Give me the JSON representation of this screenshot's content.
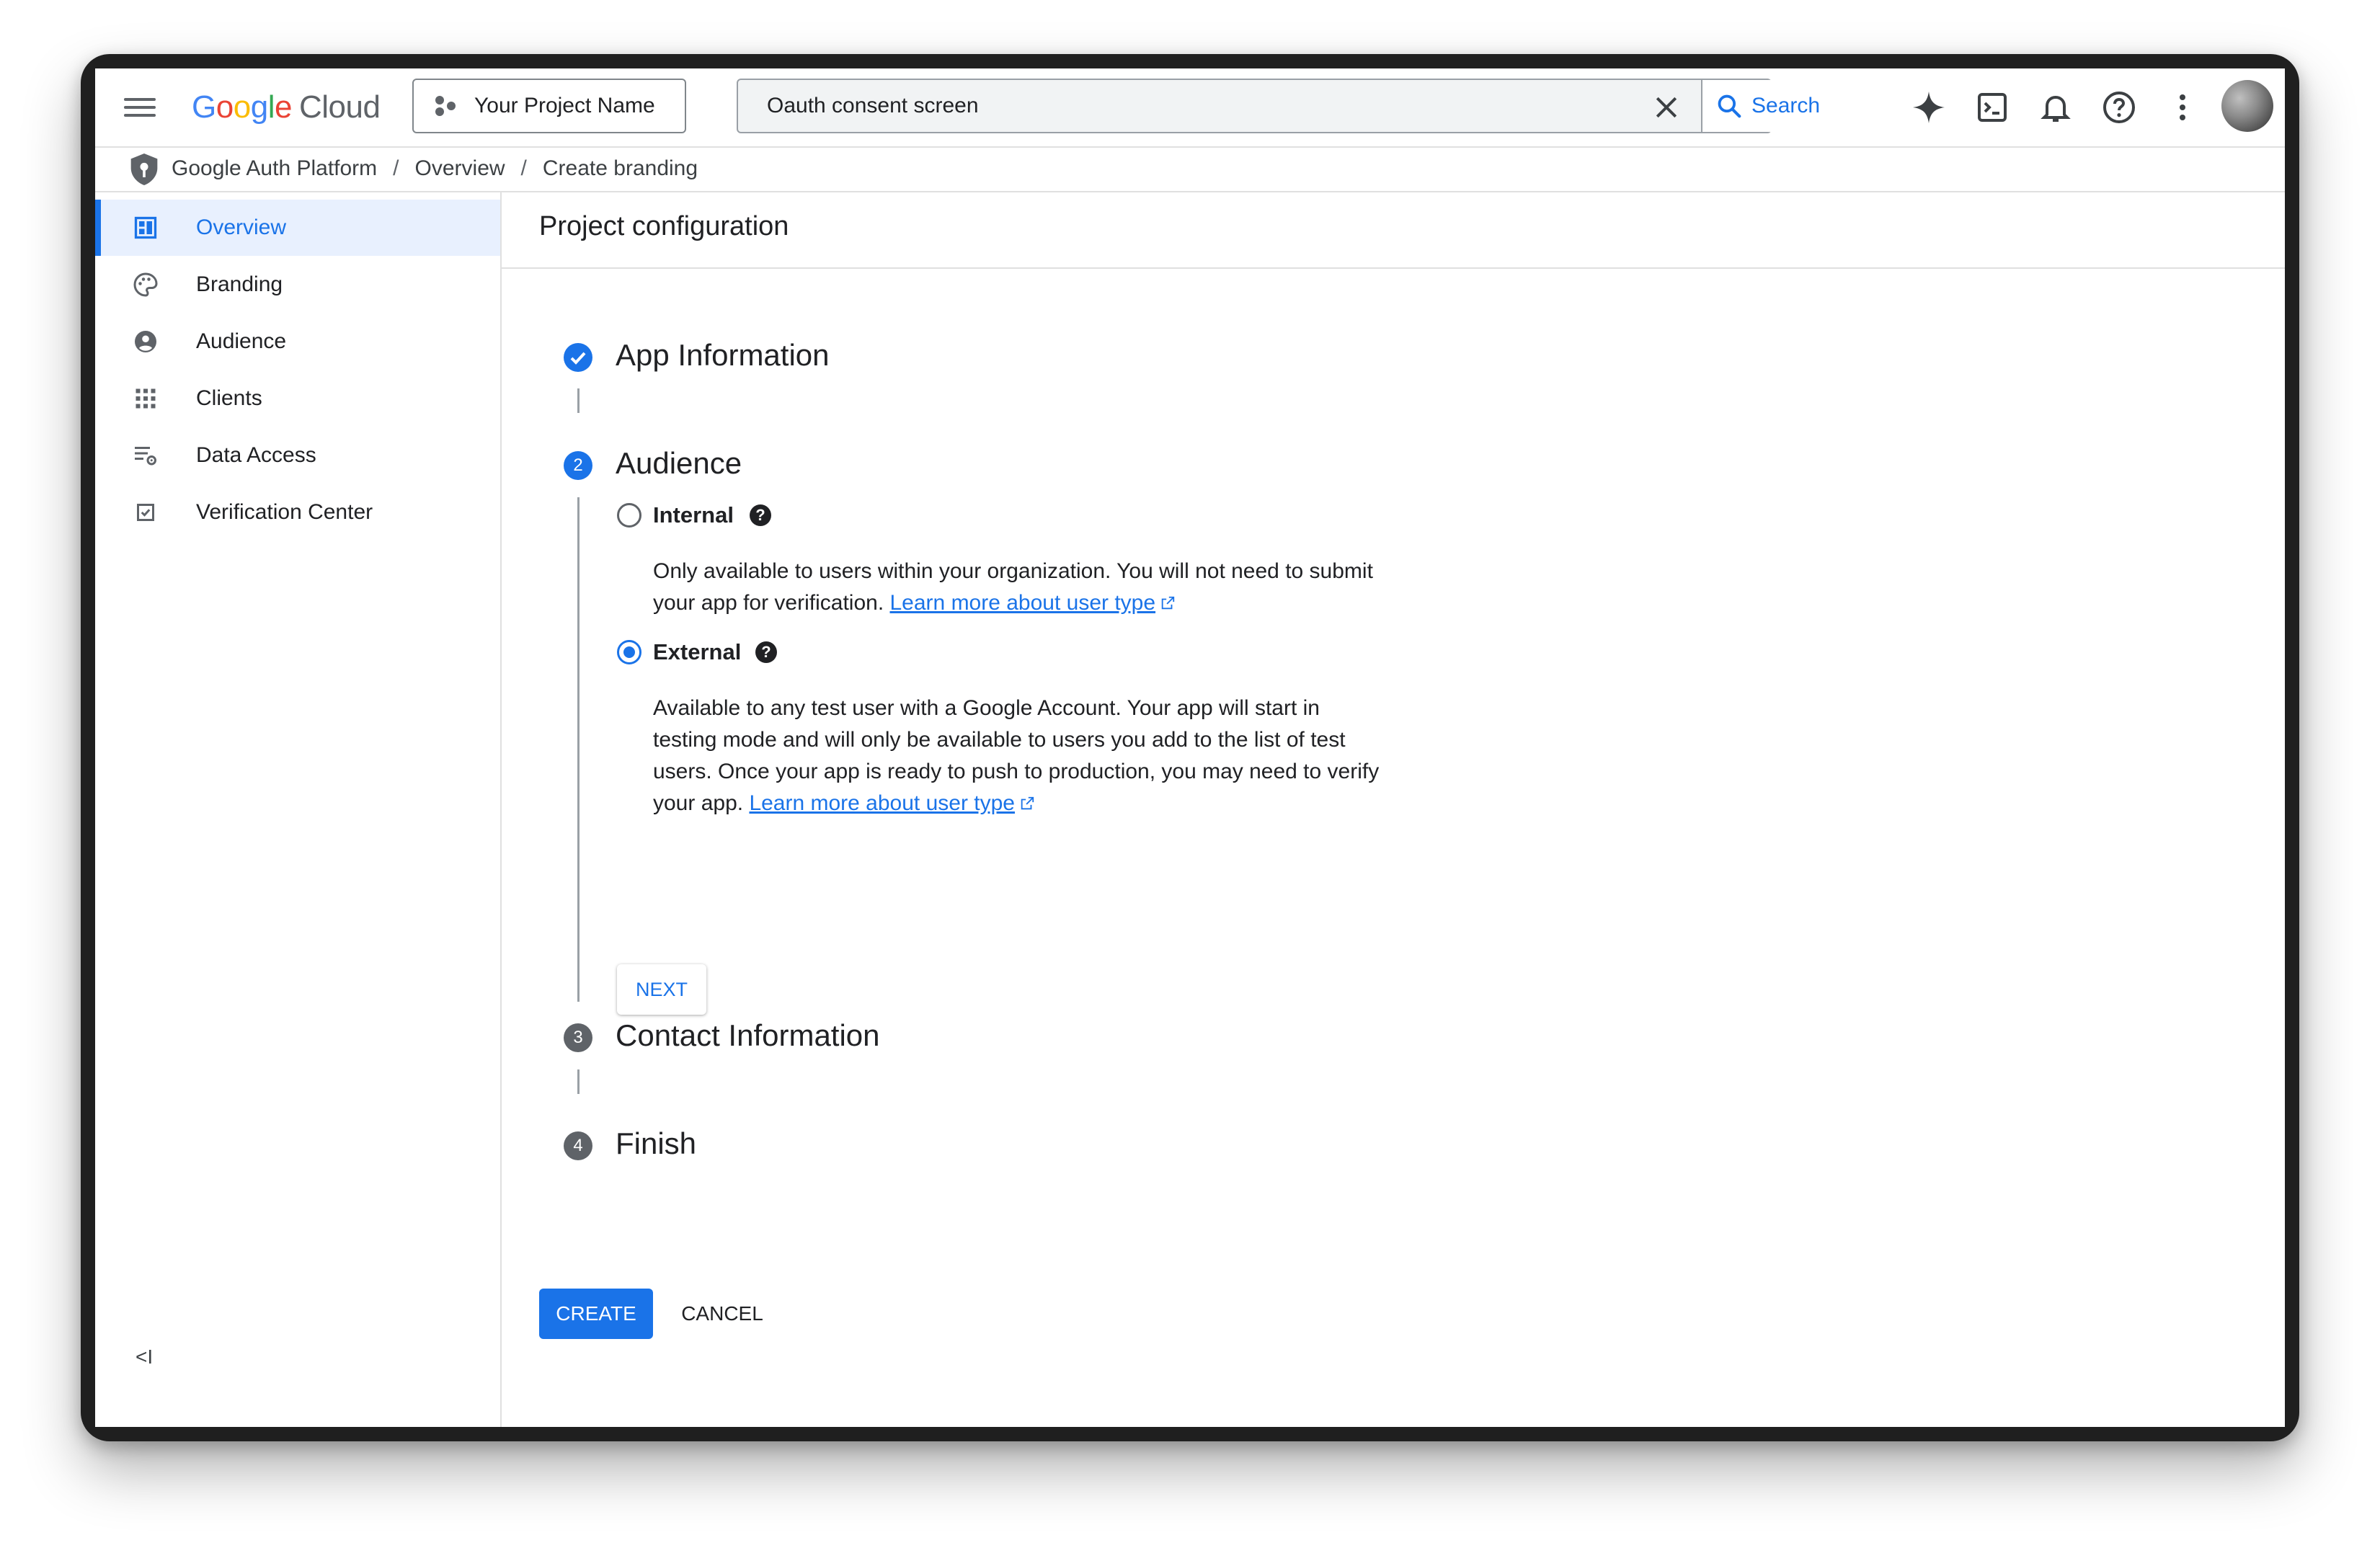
{
  "header": {
    "logo": {
      "g1": "G",
      "g2": "o",
      "g3": "o",
      "g4": "g",
      "g5": "l",
      "g6": "e",
      "cloud": "Cloud"
    },
    "project_label": "Your Project Name",
    "search_value": "Oauth consent screen",
    "search_button": "Search",
    "icons": [
      "menu-icon",
      "gemini-spark-icon",
      "cloud-shell-icon",
      "notifications-icon",
      "help-icon",
      "more-vert-icon",
      "avatar"
    ]
  },
  "breadcrumb": {
    "items": [
      "Google Auth Platform",
      "Overview",
      "Create branding"
    ],
    "separator": "/"
  },
  "sidebar": {
    "items": [
      {
        "label": "Overview",
        "icon": "dashboard-icon"
      },
      {
        "label": "Branding",
        "icon": "palette-icon"
      },
      {
        "label": "Audience",
        "icon": "account-circle-icon"
      },
      {
        "label": "Clients",
        "icon": "apps-grid-icon"
      },
      {
        "label": "Data Access",
        "icon": "data-settings-icon"
      },
      {
        "label": "Verification Center",
        "icon": "checkbox-icon"
      }
    ],
    "collapse_label": "<I"
  },
  "main": {
    "title": "Project configuration",
    "steps": [
      {
        "number": "✓",
        "title": "App Information",
        "state": "done"
      },
      {
        "number": "2",
        "title": "Audience",
        "state": "active"
      },
      {
        "number": "3",
        "title": "Contact Information",
        "state": "pending"
      },
      {
        "number": "4",
        "title": "Finish",
        "state": "pending"
      }
    ],
    "audience": {
      "internal": {
        "label": "Internal",
        "desc": "Only available to users within your organization. You will not need to submit your app for verification.",
        "link": "Learn more about user type"
      },
      "external": {
        "label": "External",
        "desc": "Available to any test user with a Google Account. Your app will start in testing mode and will only be available to users you add to the list of test users. Once your app is ready to push to production, you may need to verify your app.",
        "link": "Learn more about user type"
      },
      "selected": "External"
    },
    "next_label": "NEXT",
    "create_label": "CREATE",
    "cancel_label": "CANCEL"
  },
  "colors": {
    "accent": "#1a73e8",
    "pending_step": "#5f6368",
    "divider": "#e0e0e0"
  }
}
